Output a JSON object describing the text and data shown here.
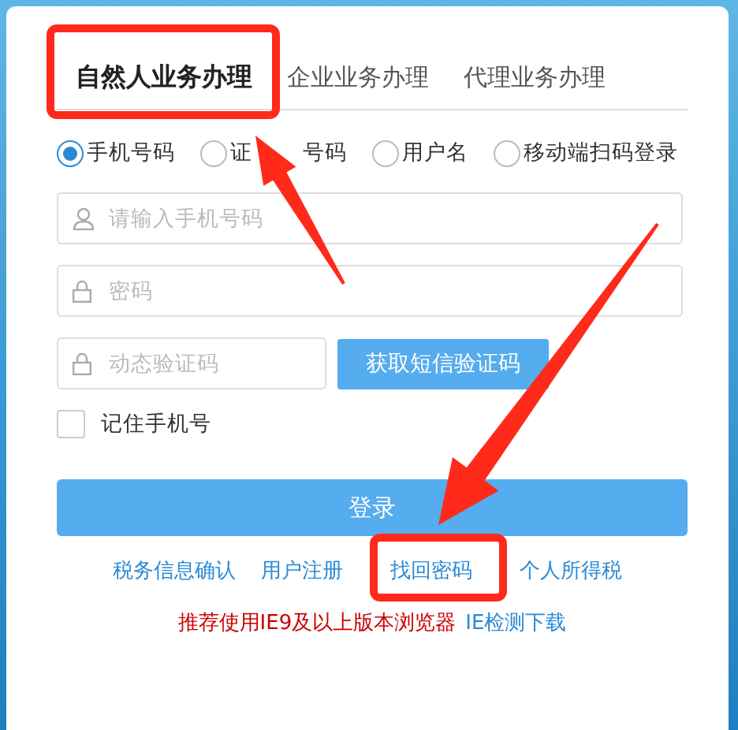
{
  "tabs": [
    {
      "label": "自然人业务办理",
      "selected": true
    },
    {
      "label": "企业业务办理",
      "selected": false
    },
    {
      "label": "代理业务办理",
      "selected": false
    }
  ],
  "login_methods": [
    {
      "label": "手机号码",
      "selected": true
    },
    {
      "label": "证",
      "label_after": "号码",
      "selected": false
    },
    {
      "label": "用户名",
      "selected": false
    },
    {
      "label": "移动端扫码登录",
      "selected": false
    }
  ],
  "fields": [
    {
      "kind": "user",
      "placeholder": "请输入手机号码"
    },
    {
      "kind": "lock",
      "placeholder": "密码"
    }
  ],
  "code_field": {
    "kind": "lock",
    "placeholder": "动态验证码"
  },
  "sms_button": "获取短信验证码",
  "remember": {
    "label": "记住手机号",
    "checked": false
  },
  "login_button": "登录",
  "links": [
    "税务信息确认",
    "用户注册",
    "找回密码",
    "个人所得税"
  ],
  "notice": {
    "text": "推荐使用IE9及以上版本浏览器",
    "link": "IE检测下载"
  }
}
